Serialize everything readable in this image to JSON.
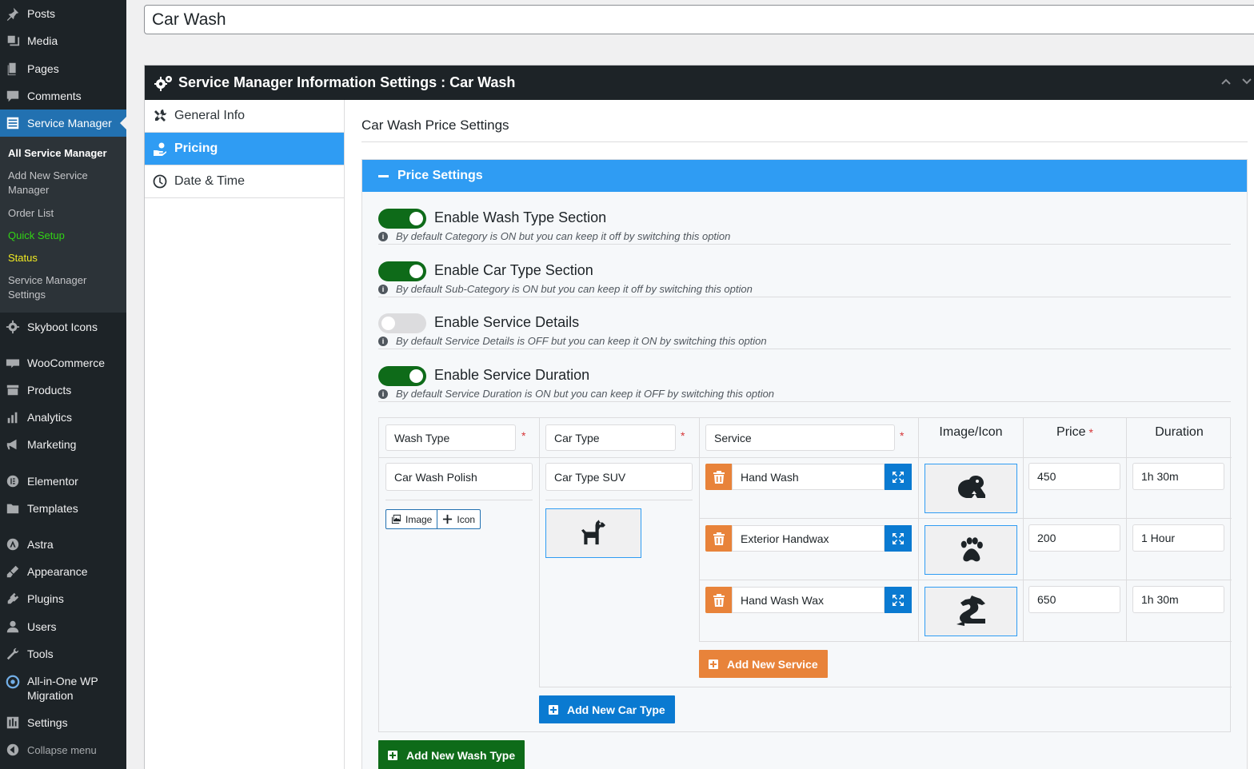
{
  "sidebar": {
    "menu": [
      {
        "label": "Posts",
        "icon": "pin-icon"
      },
      {
        "label": "Media",
        "icon": "media-icon"
      },
      {
        "label": "Pages",
        "icon": "page-icon"
      },
      {
        "label": "Comments",
        "icon": "comment-icon"
      },
      {
        "label": "Service Manager",
        "icon": "list-icon",
        "active": true
      },
      {
        "label": "Skyboot Icons",
        "icon": "gear-icon"
      },
      {
        "label": "WooCommerce",
        "icon": "woo-icon"
      },
      {
        "label": "Products",
        "icon": "archive-icon"
      },
      {
        "label": "Analytics",
        "icon": "bar-chart-icon"
      },
      {
        "label": "Marketing",
        "icon": "megaphone-icon"
      },
      {
        "label": "Elementor",
        "icon": "elementor-icon"
      },
      {
        "label": "Templates",
        "icon": "folder-icon"
      },
      {
        "label": "Astra",
        "icon": "astra-icon"
      },
      {
        "label": "Appearance",
        "icon": "brush-icon"
      },
      {
        "label": "Plugins",
        "icon": "plug-icon"
      },
      {
        "label": "Users",
        "icon": "user-icon"
      },
      {
        "label": "Tools",
        "icon": "wrench-icon"
      },
      {
        "label": "All-in-One WP",
        "label2": "Migration",
        "icon": "migration-icon"
      },
      {
        "label": "Settings",
        "icon": "settings-icon"
      },
      {
        "label": "Collapse menu",
        "icon": "collapse-icon"
      }
    ],
    "submenu": [
      {
        "label": "All Service Manager"
      },
      {
        "label": "Add New Service",
        "label2": "Manager"
      },
      {
        "label": "Order List"
      },
      {
        "label": "Quick Setup"
      },
      {
        "label": "Status"
      },
      {
        "label": "Service Manager",
        "label2": "Settings"
      }
    ]
  },
  "post_title": "Car Wash",
  "metabox": {
    "title": "Service Manager Information Settings : Car Wash",
    "tabs": [
      {
        "label": "General Info",
        "icon": "tools-icon"
      },
      {
        "label": "Pricing",
        "icon": "hand-money-icon",
        "active": true
      },
      {
        "label": "Date & Time",
        "icon": "clock-icon"
      }
    ]
  },
  "panel": {
    "title": "Car Wash Price Settings",
    "section_title": "Price Settings",
    "toggles": [
      {
        "label": "Enable Wash Type Section",
        "desc": "By default Category is ON but you can keep it off by switching this option",
        "on": true
      },
      {
        "label": "Enable Car Type Section",
        "desc": "By default Sub-Category is ON but you can keep it off by switching this option",
        "on": true
      },
      {
        "label": "Enable Service Details",
        "desc": "By default Service Details is OFF but you can keep it ON by switching this option",
        "on": false
      },
      {
        "label": "Enable Service Duration",
        "desc": "By default Service Duration is ON but you can keep it OFF by switching this option",
        "on": true
      }
    ],
    "grid": {
      "headers": {
        "wash_type": "Wash Type",
        "car_type": "Car Type",
        "service": "Service",
        "image_icon": "Image/Icon",
        "price": "Price",
        "duration": "Duration",
        "required": "*"
      },
      "wash_type_value": "Car Wash Polish",
      "image_btn": "Image",
      "icon_btn": "Icon",
      "car_type_value": "Car Type SUV",
      "car_type_icon": "dog-icon",
      "services": [
        {
          "name": "Hand Wash",
          "price": "450",
          "duration": "1h 30m",
          "icon": "frog-icon"
        },
        {
          "name": "Exterior Handwax",
          "price": "200",
          "duration": "1 Hour",
          "icon": "paw-icon"
        },
        {
          "name": "Hand Wash Wax",
          "price": "650",
          "duration": "1h 30m",
          "icon": "dragon-icon"
        }
      ],
      "add_service": "Add New Service",
      "add_car_type": "Add New Car Type",
      "add_wash_type": "Add New Wash Type"
    }
  },
  "colors": {
    "sidebar_bg": "#1d2327",
    "active_blue": "#2271b1",
    "tab_active": "#2f9cf3",
    "toggle_on": "#0e6b19",
    "orange": "#e8833a",
    "button_blue": "#0a7ad1"
  }
}
